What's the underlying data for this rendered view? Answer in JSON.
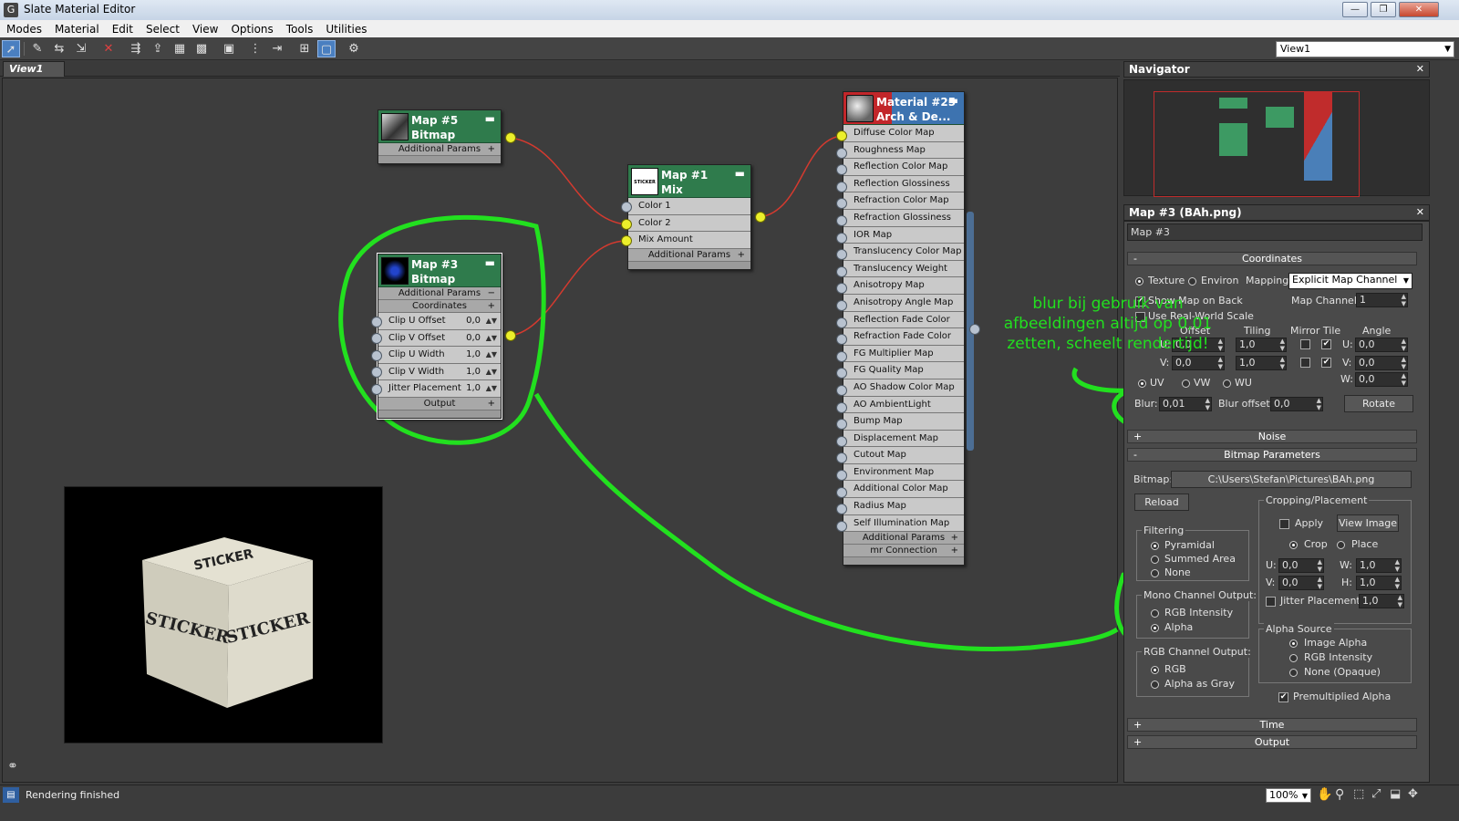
{
  "window": {
    "title": "Slate Material Editor",
    "minimize": "—",
    "restore": "❐",
    "close": "✕"
  },
  "menu": [
    "Modes",
    "Material",
    "Edit",
    "Select",
    "View",
    "Options",
    "Tools",
    "Utilities"
  ],
  "toolbar": {
    "view_select": "View1"
  },
  "view_tab": "View1",
  "nodes": {
    "map5": {
      "title1": "Map #5",
      "title2": "Bitmap",
      "section": "Additional Params"
    },
    "map1": {
      "title1": "Map #1",
      "title2": "Mix",
      "thumb_text": "STICKER",
      "rows": [
        "Color 1",
        "Color 2",
        "Mix Amount"
      ],
      "section": "Additional Params"
    },
    "map3": {
      "title1": "Map #3",
      "title2": "Bitmap",
      "sections": [
        "Additional Params",
        "Coordinates"
      ],
      "rows": [
        {
          "label": "Clip U Offset",
          "value": "0,0"
        },
        {
          "label": "Clip V Offset",
          "value": "0,0"
        },
        {
          "label": "Clip U Width",
          "value": "1,0"
        },
        {
          "label": "Clip V Width",
          "value": "1,0"
        },
        {
          "label": "Jitter Placement",
          "value": "1,0"
        }
      ],
      "output": "Output"
    },
    "material": {
      "title1": "Material #25",
      "title2": "Arch & De...",
      "slots": [
        "Diffuse Color Map",
        "Roughness Map",
        "Reflection Color Map",
        "Reflection Glossiness Map",
        "Refraction Color Map",
        "Refraction Glossiness Map",
        "IOR Map",
        "Translucency Color Map",
        "Translucency Weight Map",
        "Anisotropy Map",
        "Anisotropy Angle Map",
        "Reflection Fade Color Map",
        "Refraction Fade Color Map",
        "FG Multiplier Map",
        "FG Quality Map",
        "AO Shadow Color Map",
        "AO AmbientLight Color...",
        "Bump Map",
        "Displacement Map",
        "Cutout Map",
        "Environment Map",
        "Additional Color Map",
        "Radius Map",
        "Self Illumination Map"
      ],
      "sections": [
        "Additional Params",
        "mr Connection"
      ]
    }
  },
  "preview": {
    "cube_text": "STICKER"
  },
  "navigator": {
    "title": "Navigator"
  },
  "properties": {
    "title": "Map #3 (BAh.png)",
    "name": "Map #3",
    "rollouts": {
      "coordinates": "Coordinates",
      "noise": "Noise",
      "bitmap_params": "Bitmap Parameters",
      "time": "Time",
      "output": "Output"
    },
    "coords": {
      "texture": "Texture",
      "environ": "Environ",
      "mapping_label": "Mapping:",
      "mapping_value": "Explicit Map Channel",
      "map_channel_label": "Map Channel:",
      "map_channel_value": "1",
      "show_map_back": "Show Map on Back",
      "real_world": "Use Real-World Scale",
      "offset": "Offset",
      "tiling": "Tiling",
      "mirror_tile": "Mirror Tile",
      "angle": "Angle",
      "u": "U:",
      "v": "V:",
      "w": "W:",
      "u_offset": "0,0",
      "v_offset": "0,0",
      "u_tiling": "1,0",
      "v_tiling": "1,0",
      "u_angle": "0,0",
      "v_angle": "0,0",
      "w_angle": "0,0",
      "uv": "UV",
      "vw": "VW",
      "wu": "WU",
      "blur_label": "Blur:",
      "blur_value": "0,01",
      "blur_offset_label": "Blur offset:",
      "blur_offset_value": "0,0",
      "rotate": "Rotate"
    },
    "bitmap": {
      "bitmap_label": "Bitmap:",
      "path": "C:\\Users\\Stefan\\Pictures\\BAh.png",
      "reload": "Reload",
      "cropping_title": "Cropping/Placement",
      "apply": "Apply",
      "view_image": "View Image",
      "crop": "Crop",
      "place": "Place",
      "u_label": "U:",
      "u_val": "0,0",
      "w_label": "W:",
      "w_val": "1,0",
      "v_label": "V:",
      "v_val": "0,0",
      "h_label": "H:",
      "h_val": "1,0",
      "jitter_label": "Jitter Placement:",
      "jitter_val": "1,0",
      "filtering_title": "Filtering",
      "pyramidal": "Pyramidal",
      "summed_area": "Summed Area",
      "none": "None",
      "mono_title": "Mono Channel Output:",
      "rgb_intensity": "RGB Intensity",
      "alpha": "Alpha",
      "rgb_title": "RGB Channel Output:",
      "rgb": "RGB",
      "alpha_as_gray": "Alpha as Gray",
      "alpha_source_title": "Alpha Source",
      "image_alpha": "Image Alpha",
      "rgb_intensity2": "RGB Intensity",
      "none_opaque": "None (Opaque)",
      "premultiplied": "Premultiplied Alpha"
    }
  },
  "annotation": {
    "line1": "blur bij gebruik van",
    "line2": "afbeeldingen  altijd op 0,01",
    "line3": "zetten, scheelt rendertijd!"
  },
  "status": {
    "text": "Rendering finished",
    "zoom": "100%"
  },
  "colors": {
    "annotation_green": "#22e01f",
    "node_green": "#2f7b4c",
    "socket_active": "#ecef2b",
    "wire_red": "#d43a2f"
  }
}
